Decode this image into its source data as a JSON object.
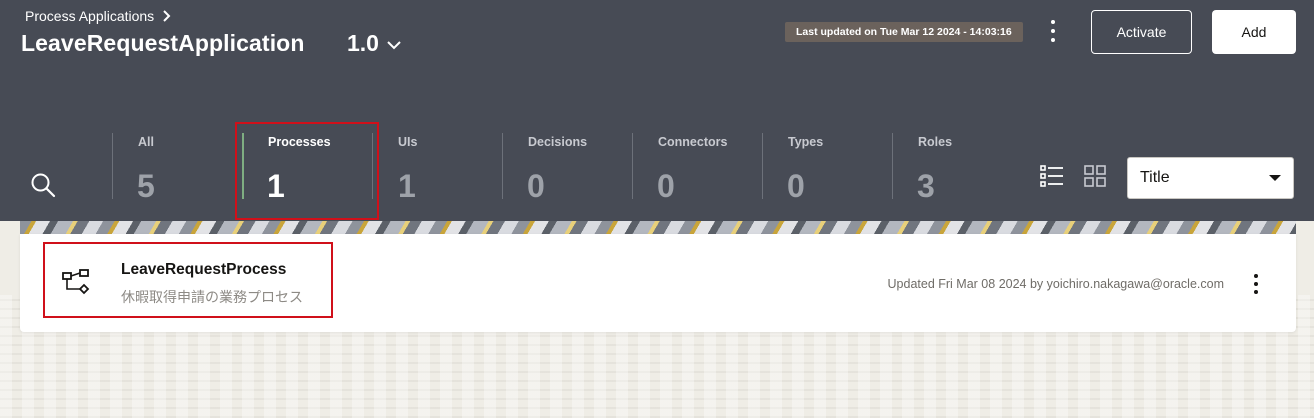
{
  "header": {
    "breadcrumb": "Process Applications",
    "app_title": "LeaveRequestApplication",
    "version": "1.0",
    "last_updated": "Last updated on Tue Mar 12 2024 - 14:03:16",
    "activate_label": "Activate",
    "add_label": "Add"
  },
  "filters": {
    "categories": [
      {
        "label": "All",
        "count": "5"
      },
      {
        "label": "Processes",
        "count": "1"
      },
      {
        "label": "UIs",
        "count": "1"
      },
      {
        "label": "Decisions",
        "count": "0"
      },
      {
        "label": "Connectors",
        "count": "0"
      },
      {
        "label": "Types",
        "count": "0"
      },
      {
        "label": "Roles",
        "count": "3"
      }
    ],
    "active_category": "Processes",
    "sort_value": "Title"
  },
  "items": [
    {
      "name": "LeaveRequestProcess",
      "description": "休暇取得申請の業務プロセス",
      "updated": "Updated Fri Mar 08 2024 by yoichiro.nakagawa@oracle.com"
    }
  ],
  "icons": {
    "search": "search-icon",
    "list_view": "list-view-icon",
    "grid_view": "grid-view-icon",
    "process": "process-flow-icon",
    "more": "kebab-menu-icon"
  },
  "colors": {
    "header_bg": "#474b55",
    "highlight": "#d0101a",
    "active_indicator": "#7fae82"
  }
}
